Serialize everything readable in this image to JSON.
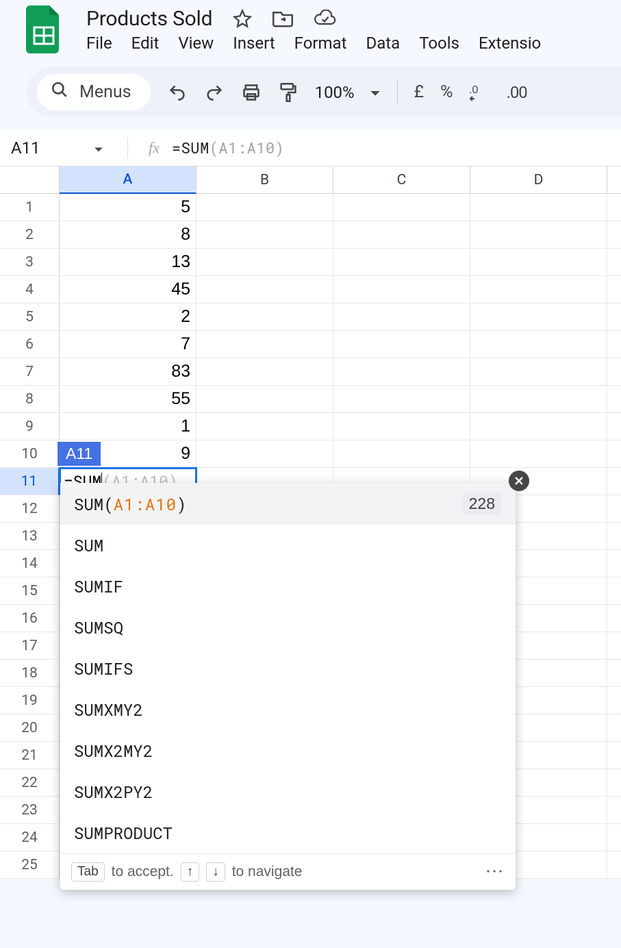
{
  "header": {
    "doc_title": "Products Sold",
    "menus": [
      "File",
      "Edit",
      "View",
      "Insert",
      "Format",
      "Data",
      "Tools",
      "Extensio"
    ]
  },
  "toolbar": {
    "menus_label": "Menus",
    "zoom": "100%",
    "currency": "£",
    "percent": "%"
  },
  "formula_bar": {
    "name_box": "A11",
    "prefix": "=SUM",
    "args": "(A1:A10)"
  },
  "columns": [
    "A",
    "B",
    "C",
    "D"
  ],
  "rows": [
    {
      "n": "1",
      "a": "5"
    },
    {
      "n": "2",
      "a": "8"
    },
    {
      "n": "3",
      "a": "13"
    },
    {
      "n": "4",
      "a": "45"
    },
    {
      "n": "5",
      "a": "2"
    },
    {
      "n": "6",
      "a": "7"
    },
    {
      "n": "7",
      "a": "83"
    },
    {
      "n": "8",
      "a": "55"
    },
    {
      "n": "9",
      "a": "1"
    },
    {
      "n": "10",
      "a": "9"
    },
    {
      "n": "11",
      "a": ""
    },
    {
      "n": "12",
      "a": ""
    },
    {
      "n": "13",
      "a": ""
    },
    {
      "n": "14",
      "a": ""
    },
    {
      "n": "15",
      "a": ""
    },
    {
      "n": "16",
      "a": ""
    },
    {
      "n": "17",
      "a": ""
    },
    {
      "n": "18",
      "a": ""
    },
    {
      "n": "19",
      "a": ""
    },
    {
      "n": "20",
      "a": ""
    },
    {
      "n": "21",
      "a": ""
    },
    {
      "n": "22",
      "a": ""
    },
    {
      "n": "23",
      "a": ""
    },
    {
      "n": "24",
      "a": ""
    },
    {
      "n": "25",
      "a": ""
    }
  ],
  "active_cell": {
    "ref_badge": "A11",
    "typed": "=SUM",
    "ghost": "(A1:A10)"
  },
  "autocomplete": {
    "first_prefix": "SUM(",
    "first_range": "A1:A10",
    "first_suffix": ")",
    "first_result": "228",
    "items": [
      "SUM",
      "SUMIF",
      "SUMSQ",
      "SUMIFS",
      "SUMXMY2",
      "SUMX2MY2",
      "SUMX2PY2",
      "SUMPRODUCT"
    ],
    "footer": {
      "tab_key": "Tab",
      "accept": "to accept.",
      "up_key": "↑",
      "down_key": "↓",
      "navigate": "to navigate"
    }
  }
}
